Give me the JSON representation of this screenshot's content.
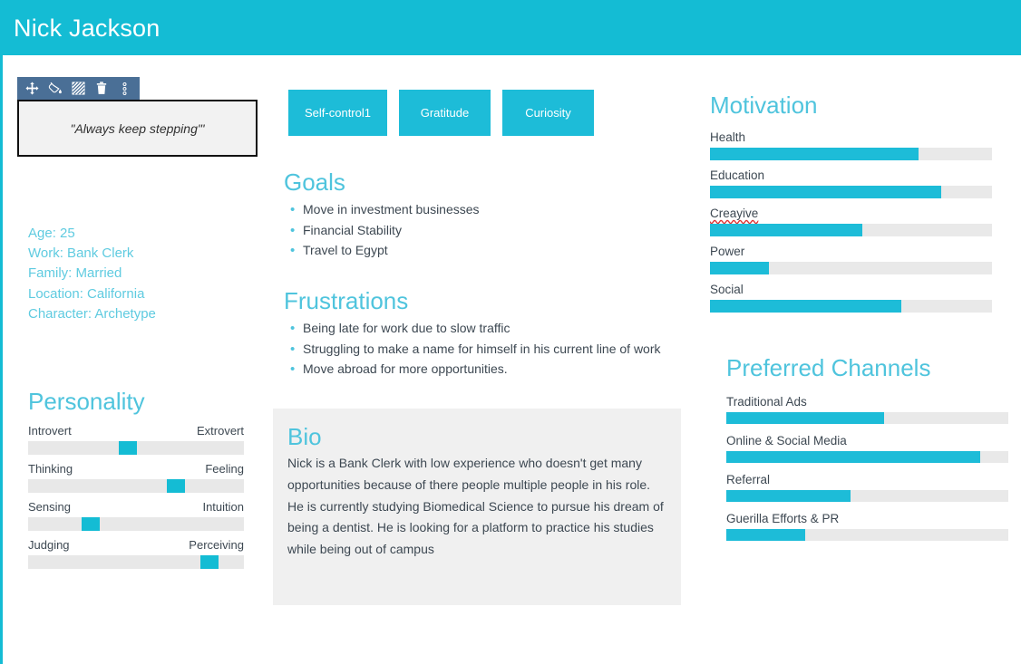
{
  "theme": {
    "accent": "#14bcd4",
    "accent_bar": "#1dbcd8",
    "heading": "#4fc4dd",
    "track": "#e9e9e9",
    "text": "#3d4852",
    "toolbar_bg": "#4a6f96",
    "panel_bg": "#f0f0f0",
    "misspell_underline": "#e03030"
  },
  "header": {
    "title": "Nick Jackson"
  },
  "quote_widget": {
    "toolbar": [
      {
        "name": "move-icon",
        "label": "Move"
      },
      {
        "name": "paint-bucket-icon",
        "label": "Fill color"
      },
      {
        "name": "pattern-fill-icon",
        "label": "Pattern"
      },
      {
        "name": "trash-icon",
        "label": "Delete"
      },
      {
        "name": "more-options-icon",
        "label": "More options"
      }
    ],
    "quote": "\"Always keep stepping\"'"
  },
  "demographics": {
    "lines": [
      "Age: 25",
      "Work: Bank Clerk",
      "Family: Married",
      "Location: California",
      "Character: Archetype"
    ]
  },
  "personality": {
    "title": "Personality",
    "sliders": [
      {
        "left": "Introvert",
        "right": "Extrovert",
        "value": 46
      },
      {
        "left": "Thinking",
        "right": "Feeling",
        "value": 70
      },
      {
        "left": "Sensing",
        "right": "Intuition",
        "value": 27
      },
      {
        "left": "Judging",
        "right": "Perceiving",
        "value": 87
      }
    ]
  },
  "tags": [
    {
      "label": "Self-control1"
    },
    {
      "label": "Gratitude"
    },
    {
      "label": "Curiosity"
    }
  ],
  "goals": {
    "title": "Goals",
    "items": [
      "Move in investment businesses",
      "Financial Stability",
      "Travel to Egypt"
    ]
  },
  "frustrations": {
    "title": "Frustrations",
    "items": [
      "Being late for work due to slow traffic",
      "Struggling to make a name for himself in his current line of work",
      "Move abroad for more opportunities."
    ]
  },
  "bio": {
    "title": "Bio",
    "text": "Nick is a Bank Clerk with low experience who doesn't get many opportunities because of there people multiple people in his role. He is currently studying Biomedical Science to pursue his dream of being a dentist. He is looking for a platform to practice his studies while being out of campus"
  },
  "motivation": {
    "title": "Motivation",
    "bars": [
      {
        "label": "Health",
        "value": 74,
        "misspelled": false
      },
      {
        "label": "Education",
        "value": 82,
        "misspelled": false
      },
      {
        "label": "Creayive",
        "value": 54,
        "misspelled": true
      },
      {
        "label": "Power",
        "value": 21,
        "misspelled": false
      },
      {
        "label": "Social",
        "value": 68,
        "misspelled": false
      }
    ]
  },
  "channels": {
    "title": "Preferred Channels",
    "bars": [
      {
        "label": "Traditional Ads",
        "value": 56,
        "misspelled": false
      },
      {
        "label": "Online & Social Media",
        "value": 90,
        "misspelled": false
      },
      {
        "label": "Referral",
        "value": 44,
        "misspelled": false
      },
      {
        "label": "Guerilla Efforts & PR",
        "value": 28,
        "misspelled": false
      }
    ]
  }
}
